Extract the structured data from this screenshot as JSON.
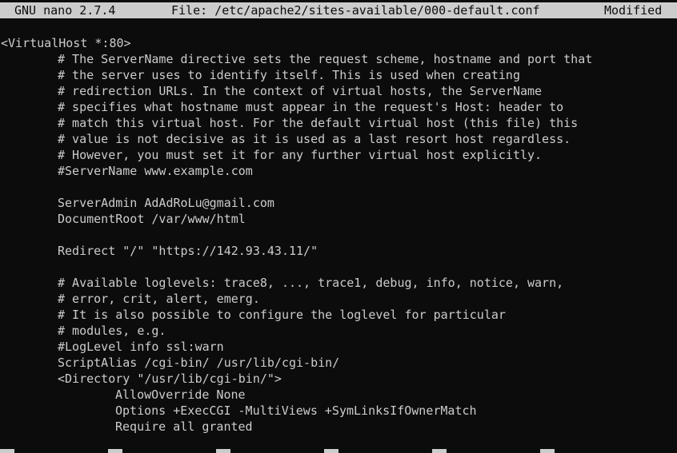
{
  "title_bar": {
    "app_name": "GNU nano 2.7.4",
    "file_label": "File: /etc/apache2/sites-available/000-default.conf",
    "status": "Modified"
  },
  "editor": {
    "lines": [
      {
        "text": "<VirtualHost *:80>",
        "indent": 0
      },
      {
        "text": "# The ServerName directive sets the request scheme, hostname and port that",
        "indent": 1
      },
      {
        "text": "# the server uses to identify itself. This is used when creating",
        "indent": 1
      },
      {
        "text": "# redirection URLs. In the context of virtual hosts, the ServerName",
        "indent": 1
      },
      {
        "text": "# specifies what hostname must appear in the request's Host: header to",
        "indent": 1
      },
      {
        "text": "# match this virtual host. For the default virtual host (this file) this",
        "indent": 1
      },
      {
        "text": "# value is not decisive as it is used as a last resort host regardless.",
        "indent": 1
      },
      {
        "text": "# However, you must set it for any further virtual host explicitly.",
        "indent": 1
      },
      {
        "text": "#ServerName www.example.com",
        "indent": 1
      },
      {
        "text": "",
        "indent": 0
      },
      {
        "text": "ServerAdmin AdAdRoLu@gmail.com",
        "indent": 1
      },
      {
        "text": "DocumentRoot /var/www/html",
        "indent": 1
      },
      {
        "text": "",
        "indent": 0
      },
      {
        "text": "Redirect \"/\" \"https://142.93.43.11/\"",
        "indent": 1
      },
      {
        "text": "",
        "indent": 0
      },
      {
        "text": "# Available loglevels: trace8, ..., trace1, debug, info, notice, warn,",
        "indent": 1
      },
      {
        "text": "# error, crit, alert, emerg.",
        "indent": 1
      },
      {
        "text": "# It is also possible to configure the loglevel for particular",
        "indent": 1
      },
      {
        "text": "# modules, e.g.",
        "indent": 1
      },
      {
        "text": "#LogLevel info ssl:warn",
        "indent": 1
      },
      {
        "text": "ScriptAlias /cgi-bin/ /usr/lib/cgi-bin/",
        "indent": 1
      },
      {
        "text": "<Directory \"/usr/lib/cgi-bin/\">",
        "indent": 1
      },
      {
        "text": "AllowOverride None",
        "indent": 2
      },
      {
        "text": "Options +ExecCGI -MultiViews +SymLinksIfOwnerMatch",
        "indent": 2
      },
      {
        "text": "Require all granted",
        "indent": 2
      }
    ]
  },
  "colors": {
    "background": "#0c0c0c",
    "foreground": "#cccccc"
  }
}
